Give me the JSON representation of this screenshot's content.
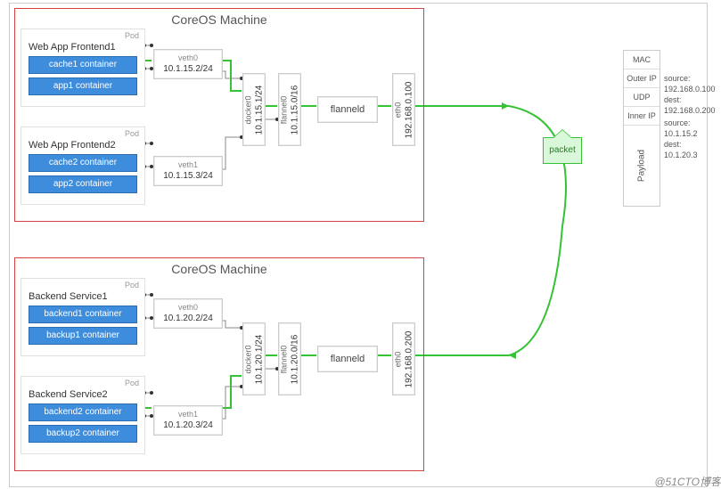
{
  "watermark": "@51CTO博客",
  "machine_title": "CoreOS Machine",
  "pod_label": "Pod",
  "packet_label": "packet",
  "flanneld_label": "flanneld",
  "machines": [
    {
      "pods": [
        {
          "title": "Web App Frontend1",
          "containers": [
            "cache1 container",
            "app1 container"
          ],
          "veth": {
            "name": "veth0",
            "ip": "10.1.15.2/24"
          }
        },
        {
          "title": "Web App Frontend2",
          "containers": [
            "cache2 container",
            "app2 container"
          ],
          "veth": {
            "name": "veth1",
            "ip": "10.1.15.3/24"
          }
        }
      ],
      "docker0": {
        "name": "docker0",
        "ip": "10.1.15.1/24"
      },
      "flannel0": {
        "name": "flannel0",
        "ip": "10.1.15.0/16"
      },
      "eth0": {
        "name": "eth0",
        "ip": "192.168.0.100"
      }
    },
    {
      "pods": [
        {
          "title": "Backend Service1",
          "containers": [
            "backend1 container",
            "backup1 container"
          ],
          "veth": {
            "name": "veth0",
            "ip": "10.1.20.2/24"
          }
        },
        {
          "title": "Backend Service2",
          "containers": [
            "backend2 container",
            "backup2 container"
          ],
          "veth": {
            "name": "veth1",
            "ip": "10.1.20.3/24"
          }
        }
      ],
      "docker0": {
        "name": "docker0",
        "ip": "10.1.20.1/24"
      },
      "flannel0": {
        "name": "flannel0",
        "ip": "10.1.20.0/16"
      },
      "eth0": {
        "name": "eth0",
        "ip": "192.168.0.200"
      }
    }
  ],
  "stack": {
    "mac": "MAC",
    "outer_ip": "Outer IP",
    "udp": "UDP",
    "inner_ip": "Inner IP",
    "payload": "Payload"
  },
  "annotations": {
    "outer": {
      "source": "source: 192.168.0.100",
      "dest": "dest: 192.168.0.200"
    },
    "inner": {
      "source": "source: 10.1.15.2",
      "dest": "dest: 10.1.20.3"
    }
  }
}
